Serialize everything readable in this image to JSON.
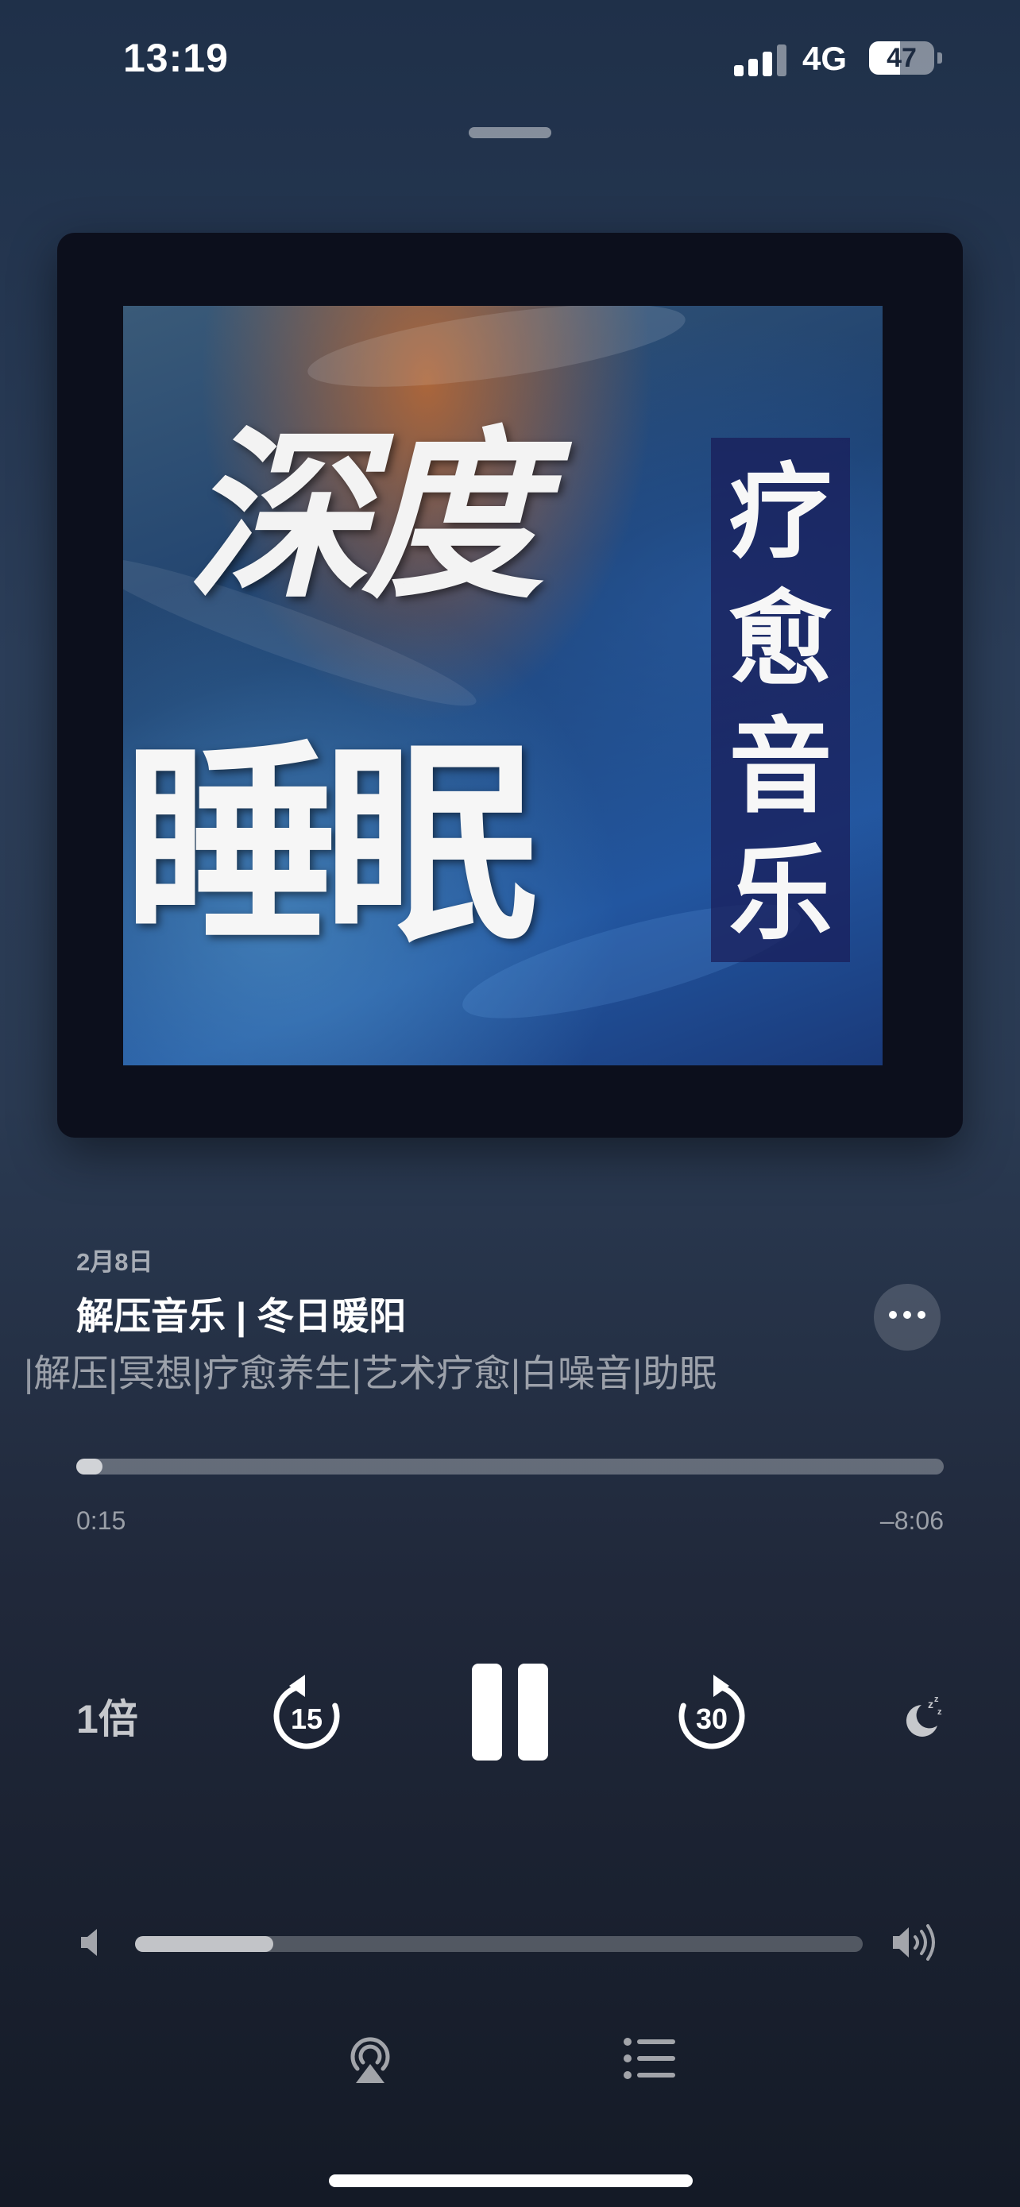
{
  "status_bar": {
    "time": "13:19",
    "network": "4G",
    "battery": "47",
    "battery_level": 0.47
  },
  "artwork": {
    "title_line1": "深度",
    "title_line2": "睡眠",
    "vertical_text": "疗愈音乐"
  },
  "track": {
    "date": "2月8日",
    "title": "解压音乐 | 冬日暖阳",
    "subtitle": "|解压|冥想|疗愈养生|艺术疗愈|白噪音|助眠"
  },
  "playback": {
    "elapsed": "0:15",
    "remaining": "–8:06",
    "progress": 0.03,
    "speed": "1倍",
    "skip_back_seconds": "15",
    "skip_forward_seconds": "30",
    "state": "playing"
  },
  "volume": {
    "level": 0.19
  },
  "icons": {
    "more": "ellipsis-icon",
    "pause": "pause-icon",
    "skip_back": "skip-back-15-icon",
    "skip_forward": "skip-forward-30-icon",
    "sleep_timer": "moon-zzz-icon",
    "volume_low": "speaker-low-icon",
    "volume_high": "speaker-high-icon",
    "airplay": "airplay-icon",
    "queue": "list-icon"
  }
}
